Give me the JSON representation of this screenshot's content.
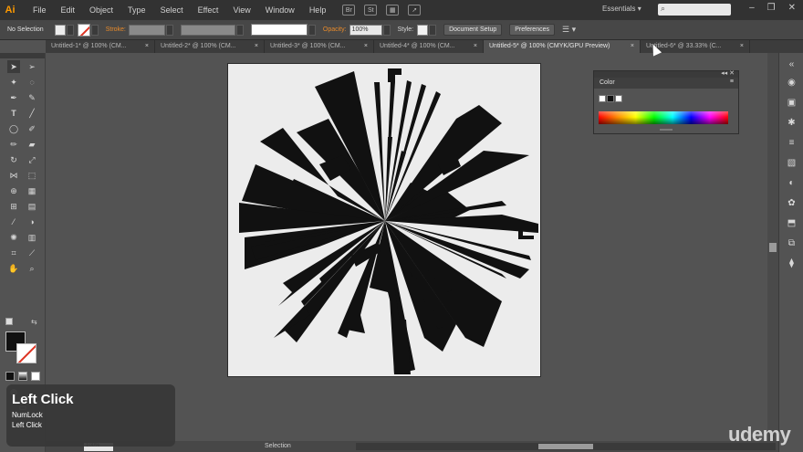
{
  "app": {
    "logo": "Ai"
  },
  "menu": {
    "items": [
      "File",
      "Edit",
      "Object",
      "Type",
      "Select",
      "Effect",
      "View",
      "Window",
      "Help"
    ],
    "icons": [
      "bridge-icon",
      "stock-icon",
      "arrange-documents-icon",
      "gpu-icon"
    ],
    "icon_labels": [
      "Br",
      "St",
      "▦",
      "➚"
    ],
    "workspace": "Essentials",
    "window_controls": [
      "–",
      "❐",
      "✕"
    ]
  },
  "control": {
    "selection": "No Selection",
    "stroke_label": "Stroke:",
    "opacity_label": "Opacity:",
    "opacity_value": "100%",
    "style_label": "Style:",
    "document_setup": "Document Setup",
    "preferences": "Preferences"
  },
  "tabs": [
    {
      "label": "Untitled-1* @ 100% (CM...",
      "active": false
    },
    {
      "label": "Untitled-2* @ 100% (CM...",
      "active": false
    },
    {
      "label": "Untitled-3* @ 100% (CM...",
      "active": false
    },
    {
      "label": "Untitled-4* @ 100% (CM...",
      "active": false
    },
    {
      "label": "Untitled-5* @ 100% (CMYK/GPU Preview)",
      "active": true
    },
    {
      "label": "Untitled-6* @ 33.33% (C...",
      "active": false
    }
  ],
  "tab_close": "×",
  "color_panel": {
    "title": "Color",
    "menu": "≡",
    "top_controls": "◂◂ ✕"
  },
  "status": {
    "zoom": "100%",
    "tool": "Selection"
  },
  "overlay": {
    "title": "Left Click",
    "line1": "NumLock",
    "line2": "Left Click"
  },
  "watermark": "udemy",
  "colors": {
    "accent_orange": "#e88a2a",
    "artboard": "#ececec",
    "art": "#111111"
  }
}
